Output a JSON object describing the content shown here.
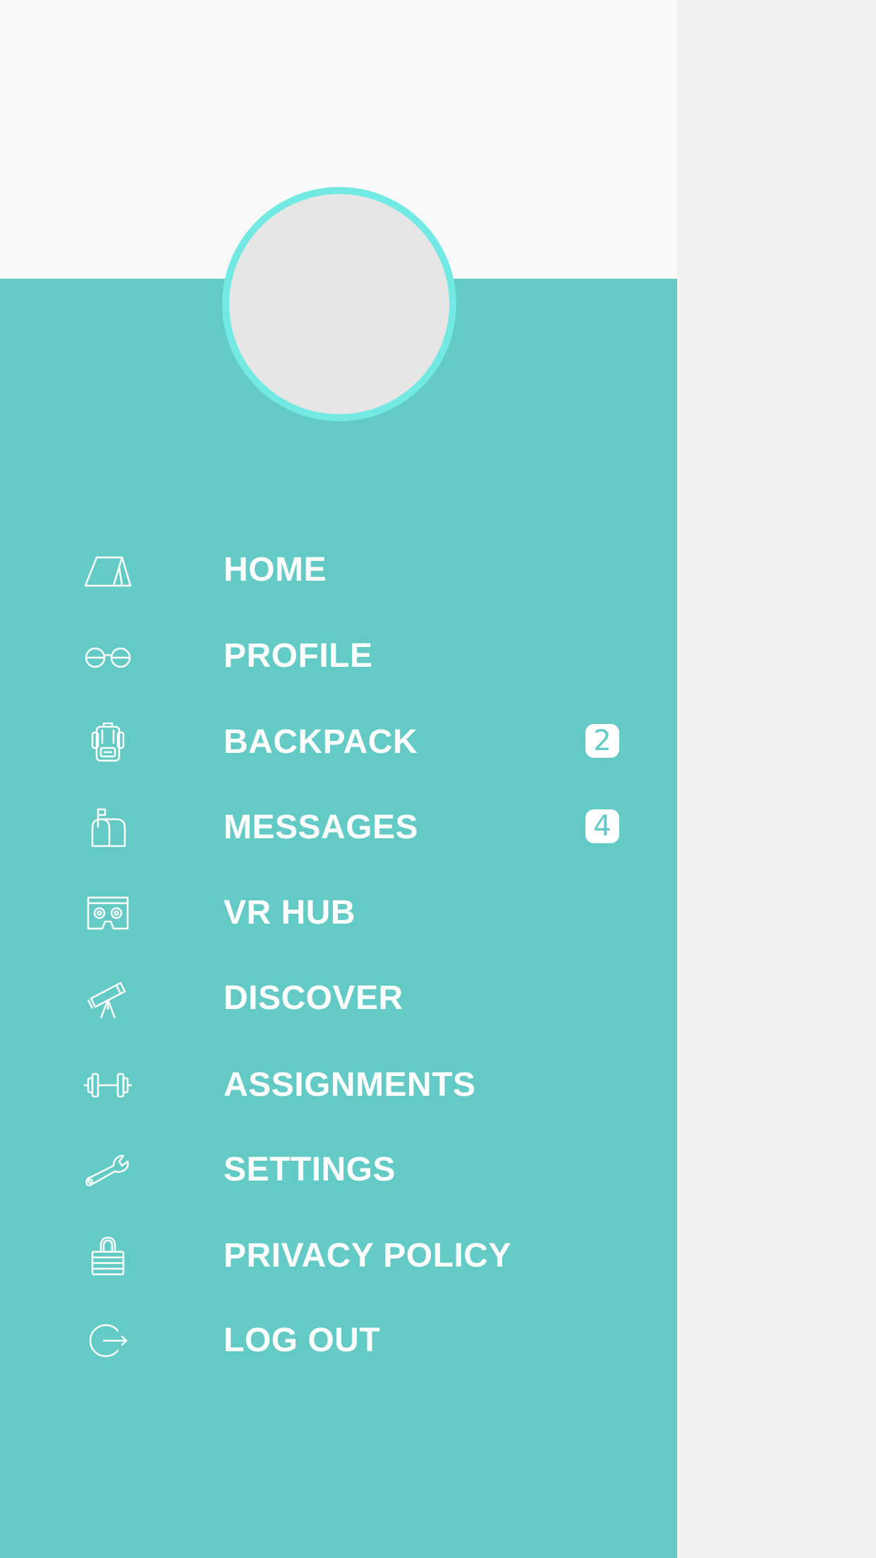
{
  "colors": {
    "drawer_bg": "#63cac5",
    "header_bg": "#f9f9f9",
    "avatar_ring": "#72e9e2",
    "avatar_fill": "#e6e6e6",
    "right_bg": "#f1f1f1"
  },
  "menu": {
    "items": [
      {
        "label": "HOME",
        "icon": "tent-icon"
      },
      {
        "label": "PROFILE",
        "icon": "glasses-icon"
      },
      {
        "label": "BACKPACK",
        "icon": "backpack-icon",
        "badge": "2"
      },
      {
        "label": "MESSAGES",
        "icon": "mailbox-icon",
        "badge": "4"
      },
      {
        "label": "VR HUB",
        "icon": "vr-headset-icon"
      },
      {
        "label": "DISCOVER",
        "icon": "telescope-icon"
      },
      {
        "label": "ASSIGNMENTS",
        "icon": "dumbbell-icon"
      },
      {
        "label": "SETTINGS",
        "icon": "wrench-icon"
      },
      {
        "label": "PRIVACY POLICY",
        "icon": "lock-icon"
      },
      {
        "label": "LOG OUT",
        "icon": "logout-icon"
      }
    ]
  }
}
